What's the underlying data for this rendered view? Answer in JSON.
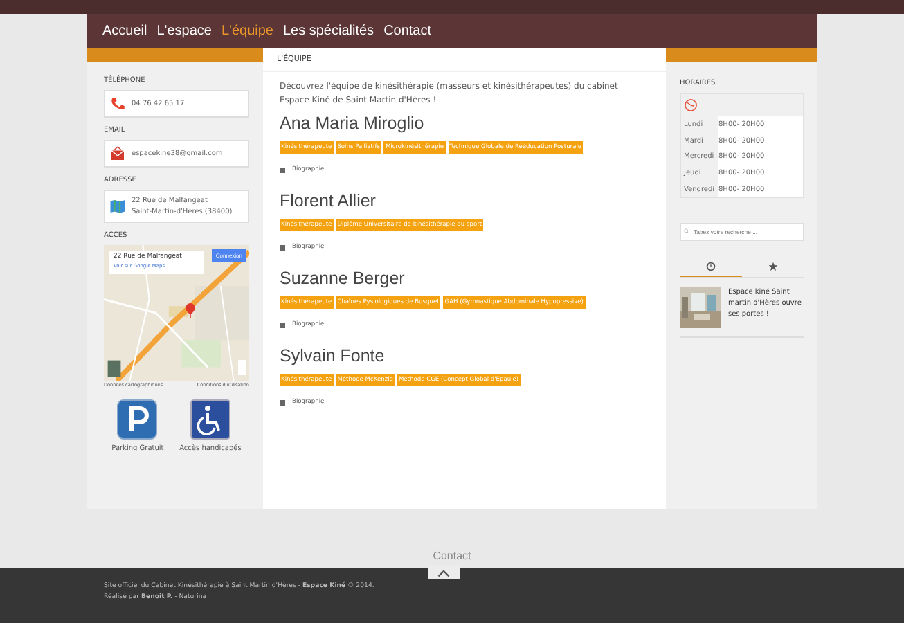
{
  "nav": [
    {
      "label": "Accueil",
      "selected": false
    },
    {
      "label": "L'espace",
      "selected": false
    },
    {
      "label": "L'équipe",
      "selected": true
    },
    {
      "label": "Les spécialités",
      "selected": false
    },
    {
      "label": "Contact",
      "selected": false
    }
  ],
  "left": {
    "contacts": [
      {
        "kind": "phone",
        "heading": "TÉLÉPHONE",
        "lines": [
          "04 76 42 65 17"
        ]
      },
      {
        "kind": "email",
        "heading": "EMAIL",
        "lines": [
          "espacekine38@gmail.com"
        ]
      },
      {
        "kind": "address",
        "heading": "ADRESSE",
        "lines": [
          "22 Rue de Malfangeat",
          "Saint-Martin-d'Hères (38400)"
        ]
      }
    ],
    "access_heading": "ACCÈS",
    "map": {
      "popup_title": "22 Rue de Malfangeat",
      "popup_link": "Voir sur Google Maps",
      "sign_in": "Connexion",
      "attribution": "Données cartographiques",
      "terms": "Conditions d'utilisation"
    },
    "badges": [
      {
        "kind": "parking",
        "label": "Parking Gratuit"
      },
      {
        "kind": "accessible",
        "label": "Accès handicapés"
      }
    ]
  },
  "main": {
    "breadcrumb": "L'ÉQUIPE",
    "intro": "Découvrez l'équipe de kinésithérapie (masseurs et kinésithérapeutes) du cabinet Espace Kiné de Saint Martin d'Hères !",
    "people": [
      {
        "name": "Ana Maria Miroglio",
        "tags": [
          "Kinésithérapeute",
          "Soins Palliatifs",
          "Microkinésithérapie",
          "Technique Globale de Rééducation Posturale"
        ],
        "bio": "Biographie"
      },
      {
        "name": "Florent Allier",
        "tags": [
          "Kinésithérapeute",
          "Diplôme Universitaire de kinésithérapie du sport"
        ],
        "bio": "Biographie"
      },
      {
        "name": "Suzanne Berger",
        "tags": [
          "Kinésithérapeute",
          "Chaînes Pysiologiques de Busquet",
          "GAH (Gymnastique Abdominale Hypopressive)"
        ],
        "bio": "Biographie"
      },
      {
        "name": "Sylvain Fonte",
        "tags": [
          "Kinésithérapeute",
          "Méthode McKenzie",
          "Méthode CGE (Concept Global d'Epaule)"
        ],
        "bio": "Biographie"
      }
    ]
  },
  "right": {
    "hours_heading": "HORAIRES",
    "hours": [
      {
        "day": "Lundi",
        "time": "8H00- 20H00"
      },
      {
        "day": "Mardi",
        "time": "8H00- 20H00"
      },
      {
        "day": "Mercredi",
        "time": "8H00- 20H00"
      },
      {
        "day": "Jeudi",
        "time": "8H00- 20H00"
      },
      {
        "day": "Vendredi",
        "time": "8H00- 20H00"
      }
    ],
    "search": {
      "placeholder": "Tapez votre recherche ..."
    },
    "tabs": [
      {
        "kind": "recent",
        "selected": true
      },
      {
        "kind": "popular",
        "selected": false
      }
    ],
    "posts": [
      {
        "title": "Espace kiné Saint martin d'Hères ouvre ses portes !"
      }
    ]
  },
  "contact_link": "Contact",
  "footer": {
    "line1": "Site officiel du Cabinet Kinésithérapie à Saint Martin d'Hères - **Espace Kiné** © 2014.",
    "line2": "Réalisé par **Benoit P.** - Naturina"
  }
}
